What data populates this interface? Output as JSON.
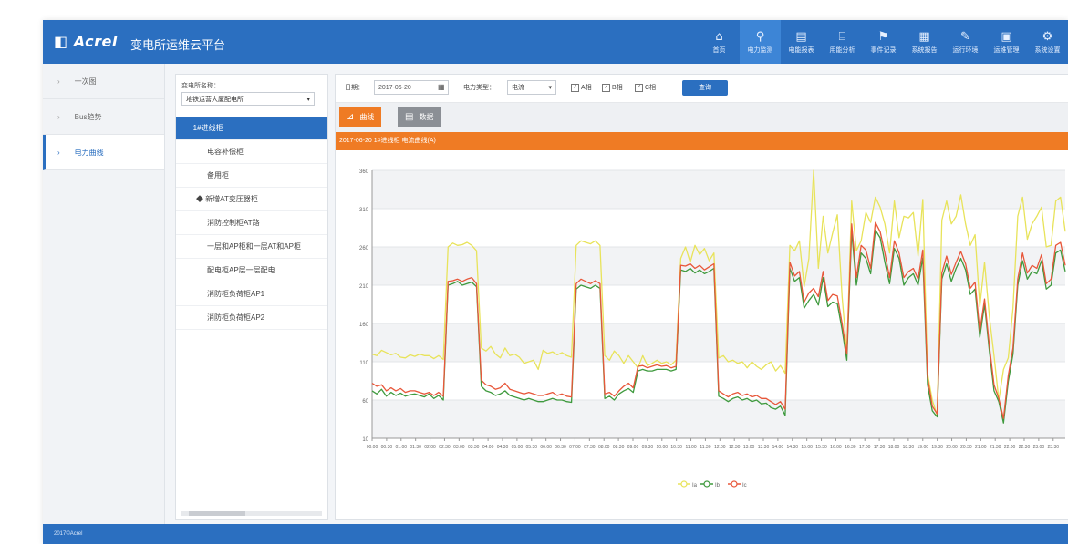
{
  "header": {
    "logo": "Acrel",
    "title": "变电所运维云平台",
    "nav": [
      {
        "label": "首页",
        "icon": "home-icon",
        "glyph": "⌂",
        "active": false
      },
      {
        "label": "电力监测",
        "icon": "monitor-icon",
        "glyph": "⚲",
        "active": true
      },
      {
        "label": "电能报表",
        "icon": "report-icon",
        "glyph": "▤",
        "active": false
      },
      {
        "label": "用能分析",
        "icon": "analysis-icon",
        "glyph": "⌸",
        "active": false
      },
      {
        "label": "事件记录",
        "icon": "event-icon",
        "glyph": "⚑",
        "active": false
      },
      {
        "label": "系统报告",
        "icon": "document-icon",
        "glyph": "▦",
        "active": false
      },
      {
        "label": "运行环境",
        "icon": "environment-icon",
        "glyph": "✎",
        "active": false
      },
      {
        "label": "运维管理",
        "icon": "maintenance-icon",
        "glyph": "▣",
        "active": false
      },
      {
        "label": "系统设置",
        "icon": "settings-icon",
        "glyph": "⚙",
        "active": false
      }
    ]
  },
  "sidebar": {
    "items": [
      {
        "label": "一次图",
        "active": false
      },
      {
        "label": "Bus趋势",
        "active": false
      },
      {
        "label": "电力曲线",
        "active": true
      }
    ]
  },
  "tree": {
    "label": "变电所名称：",
    "selected": "地铁运营大厦配电所",
    "nodes": [
      {
        "label": "1#进线柜",
        "kind": "sel"
      },
      {
        "label": "电容补偿柜",
        "kind": "leaf"
      },
      {
        "label": "备用柜",
        "kind": "leaf"
      },
      {
        "label": "◆ 新增AT变压器柜",
        "kind": "grp"
      },
      {
        "label": "消防控制柜AT路",
        "kind": "leaf"
      },
      {
        "label": "一层和AP柜和一层AT和AP柜",
        "kind": "leaf"
      },
      {
        "label": "配电柜AP层一层配电",
        "kind": "leaf"
      },
      {
        "label": "消防柜负荷柜AP1",
        "kind": "leaf"
      },
      {
        "label": "消防柜负荷柜AP2",
        "kind": "leaf"
      }
    ]
  },
  "query": {
    "date_label": "日期：",
    "date": "2017-06-20",
    "type_label": "电力类型：",
    "type_value": "电流",
    "checks": [
      "A相",
      "B相",
      "C相"
    ],
    "button": "查询"
  },
  "tabs": {
    "chart": "曲线",
    "data": "数据"
  },
  "info_bar": "2017-06-20  1#进线柜  电流曲线(A)",
  "footer": "2017©Acrel",
  "chart_data": {
    "type": "line",
    "yticks": [
      "10",
      "60",
      "110",
      "160",
      "210",
      "260",
      "310",
      "360"
    ],
    "ylim": [
      10,
      360
    ],
    "x_start": "00:00",
    "x_end": "23:55",
    "legend": [
      "Ia",
      "Ib",
      "Ic"
    ],
    "series": [
      {
        "name": "Ia",
        "color": "#e8e35a",
        "values": [
          120,
          118,
          125,
          122,
          119,
          121,
          116,
          115,
          119,
          117,
          120,
          118,
          118,
          114,
          118,
          113,
          260,
          265,
          262,
          263,
          266,
          262,
          255,
          128,
          124,
          130,
          120,
          115,
          128,
          118,
          120,
          116,
          108,
          110,
          112,
          100,
          125,
          121,
          123,
          119,
          122,
          118,
          116,
          262,
          268,
          266,
          264,
          268,
          262,
          118,
          112,
          124,
          118,
          108,
          118,
          110,
          102,
          118,
          105,
          108,
          112,
          108,
          110,
          106,
          112,
          245,
          260,
          240,
          262,
          250,
          258,
          242,
          252,
          115,
          118,
          110,
          112,
          108,
          110,
          102,
          110,
          104,
          100,
          106,
          110,
          98,
          105,
          95,
          262,
          255,
          268,
          208,
          245,
          360,
          232,
          300,
          252,
          278,
          302,
          195,
          122,
          320,
          255,
          268,
          305,
          292,
          325,
          312,
          290,
          252,
          320,
          272,
          300,
          298,
          305,
          248,
          322,
          95,
          60,
          40,
          295,
          320,
          290,
          300,
          328,
          290,
          262,
          276,
          182,
          240,
          170,
          118,
          60,
          100,
          115,
          180,
          300,
          325,
          270,
          290,
          300,
          312,
          260,
          262,
          320,
          325,
          280
        ]
      },
      {
        "name": "Ib",
        "color": "#3f9a3e",
        "values": [
          72,
          68,
          74,
          65,
          70,
          66,
          69,
          65,
          67,
          68,
          66,
          64,
          68,
          62,
          66,
          60,
          210,
          212,
          215,
          210,
          212,
          214,
          208,
          78,
          72,
          70,
          66,
          68,
          72,
          66,
          64,
          62,
          60,
          62,
          60,
          58,
          58,
          60,
          62,
          60,
          60,
          58,
          57,
          205,
          210,
          208,
          206,
          210,
          206,
          62,
          65,
          60,
          68,
          72,
          75,
          70,
          98,
          100,
          98,
          98,
          100,
          100,
          100,
          98,
          100,
          230,
          228,
          232,
          226,
          230,
          225,
          228,
          232,
          65,
          62,
          58,
          62,
          64,
          60,
          62,
          58,
          60,
          55,
          56,
          50,
          48,
          52,
          40,
          232,
          215,
          220,
          180,
          190,
          198,
          184,
          220,
          182,
          188,
          186,
          152,
          112,
          280,
          210,
          252,
          245,
          225,
          282,
          272,
          240,
          212,
          258,
          245,
          210,
          220,
          225,
          210,
          246,
          80,
          46,
          38,
          218,
          238,
          215,
          232,
          245,
          230,
          198,
          205,
          142,
          185,
          125,
          72,
          58,
          30,
          84,
          120,
          210,
          242,
          218,
          228,
          225,
          242,
          205,
          210,
          252,
          256,
          228
        ]
      },
      {
        "name": "Ic",
        "color": "#e8573a",
        "values": [
          82,
          78,
          80,
          72,
          76,
          72,
          75,
          70,
          72,
          72,
          70,
          68,
          70,
          66,
          70,
          65,
          215,
          216,
          218,
          215,
          218,
          220,
          212,
          86,
          80,
          78,
          74,
          76,
          82,
          74,
          72,
          70,
          68,
          70,
          68,
          66,
          66,
          68,
          70,
          66,
          68,
          65,
          64,
          212,
          218,
          215,
          212,
          216,
          212,
          68,
          70,
          65,
          72,
          78,
          82,
          76,
          104,
          105,
          102,
          104,
          106,
          104,
          105,
          102,
          104,
          236,
          235,
          238,
          232,
          236,
          230,
          234,
          238,
          72,
          68,
          64,
          68,
          70,
          66,
          68,
          64,
          66,
          62,
          62,
          58,
          54,
          58,
          48,
          240,
          222,
          228,
          188,
          200,
          206,
          195,
          228,
          190,
          198,
          196,
          160,
          120,
          290,
          220,
          262,
          256,
          232,
          292,
          280,
          252,
          220,
          268,
          252,
          220,
          228,
          232,
          218,
          256,
          90,
          52,
          42,
          226,
          248,
          224,
          240,
          254,
          238,
          206,
          214,
          150,
          192,
          132,
          80,
          62,
          36,
          92,
          128,
          218,
          252,
          226,
          236,
          232,
          250,
          212,
          218,
          262,
          266,
          236
        ]
      }
    ]
  }
}
